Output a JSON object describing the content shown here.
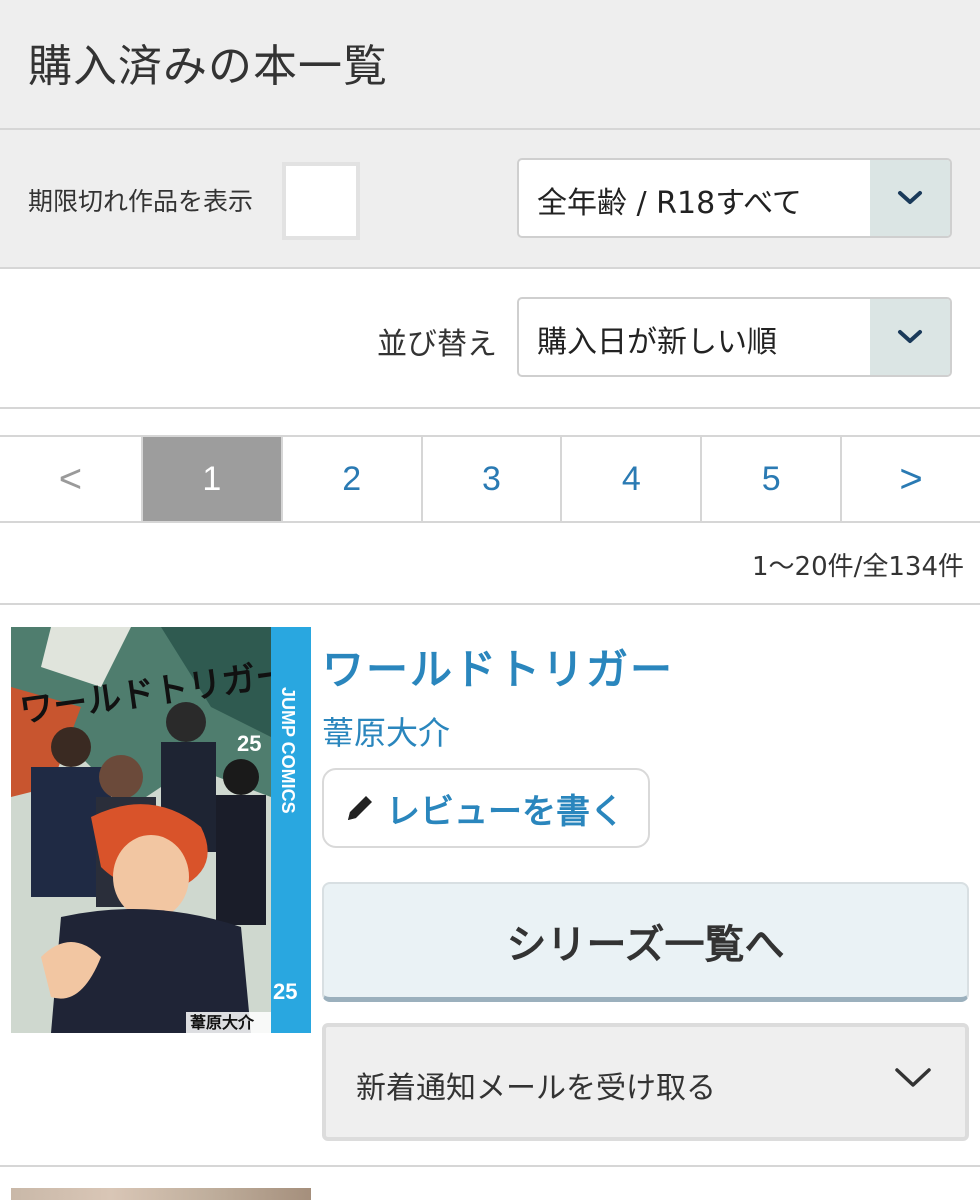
{
  "header": {
    "title": "購入済みの本一覧"
  },
  "filters": {
    "expired_label": "期限切れ作品を表示",
    "expired_checked": false,
    "age_select": "全年齢 / R18すべて"
  },
  "sort": {
    "label": "並び替え",
    "selected": "購入日が新しい順"
  },
  "pagination": {
    "prev": "<",
    "pages": [
      "1",
      "2",
      "3",
      "4",
      "5"
    ],
    "current": "1",
    "next": ">"
  },
  "result_count": "1〜20件/全134件",
  "book": {
    "title": "ワールドトリガー",
    "author": "葦原大介",
    "review_label": "レビューを書く",
    "series_label": "シリーズ一覧へ",
    "mail_label": "新着通知メールを受け取る",
    "cover_text": {
      "series_logo": "ワールドトリガー",
      "volume": "25",
      "imprint": "JUMP COMICS",
      "author": "葦原大介"
    }
  },
  "colors": {
    "link": "#2a86bd",
    "active_page": "#9d9d9d",
    "header_bg": "#eeeeee",
    "cover_spine": "#29a7e0"
  },
  "icons": {
    "select_chevron": "chevron-down-icon",
    "review": "pencil-icon",
    "mail_toggle": "chevron-down-icon"
  }
}
